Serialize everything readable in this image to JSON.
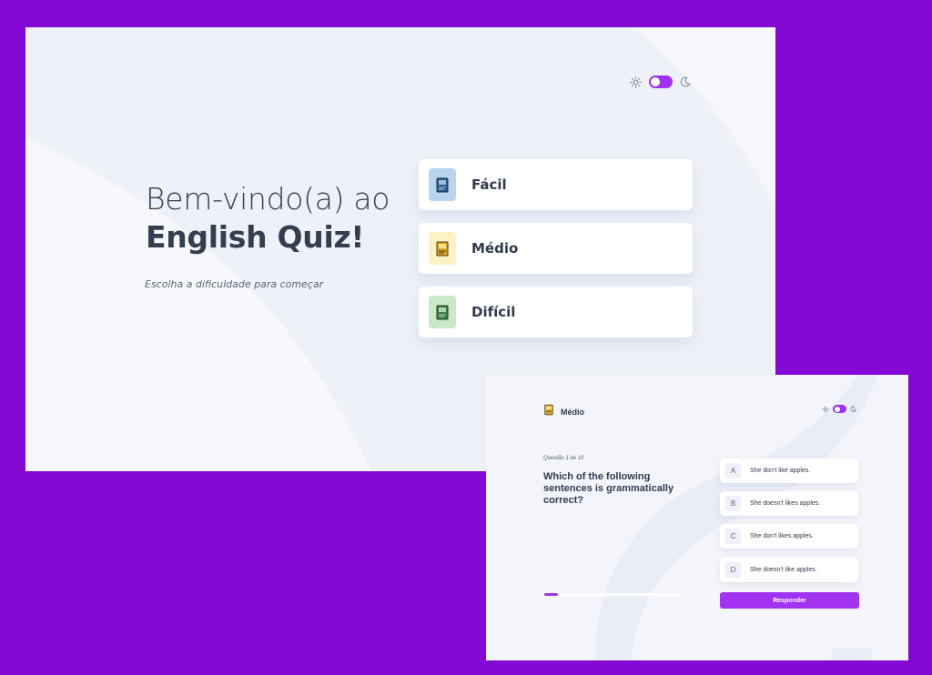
{
  "colors": {
    "background": "#8509d4",
    "accent": "#a032f0",
    "text_dark": "#2f3b4c",
    "easy_icon_bg": "#b9d4ee",
    "medium_icon_bg": "#fdf2c4",
    "hard_icon_bg": "#cbe8c9"
  },
  "welcome": {
    "title_line1": "Bem-vindo(a) ao",
    "title_line2": "English Quiz!",
    "subtitle": "Escolha a dificuldade para começar",
    "theme_icons": [
      "sun-icon",
      "moon-icon"
    ],
    "levels": [
      {
        "label": "Fácil",
        "icon": "blue-book-icon"
      },
      {
        "label": "Médio",
        "icon": "yellow-book-icon"
      },
      {
        "label": "Difícil",
        "icon": "green-book-icon"
      }
    ]
  },
  "quiz": {
    "level_label": "Médio",
    "level_icon": "yellow-book-icon",
    "counter": "Questão 1 de 10",
    "question": "Which of the following sentences is grammatically correct?",
    "progress_fraction": 0.1,
    "options": [
      {
        "letter": "A",
        "text": "She don't like apples."
      },
      {
        "letter": "B",
        "text": "She doesn't likes apples."
      },
      {
        "letter": "C",
        "text": "She don't likes apples."
      },
      {
        "letter": "D",
        "text": "She doesn't like apples."
      }
    ],
    "answer_button": "Responder"
  }
}
